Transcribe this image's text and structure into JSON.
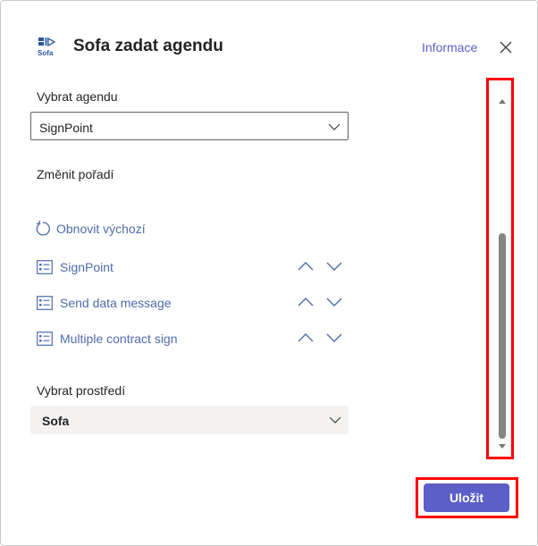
{
  "header": {
    "app_icon_caption": "Sofa",
    "title": "Sofa zadat agendu",
    "info_link": "Informace"
  },
  "agenda": {
    "label": "Vybrat agendu",
    "selected": "SignPoint"
  },
  "order": {
    "label": "Změnit pořadí",
    "reset_label": "Obnovit výchozí",
    "items": [
      {
        "label": "SignPoint"
      },
      {
        "label": "Send data message"
      },
      {
        "label": "Multiple contract sign"
      }
    ]
  },
  "environment": {
    "label": "Vybrat prostředí",
    "selected": "Sofa"
  },
  "footer": {
    "save_label": "Uložit"
  },
  "colors": {
    "accent": "#5b5fc7",
    "link": "#4f6bab",
    "highlight": "#ff0000"
  }
}
